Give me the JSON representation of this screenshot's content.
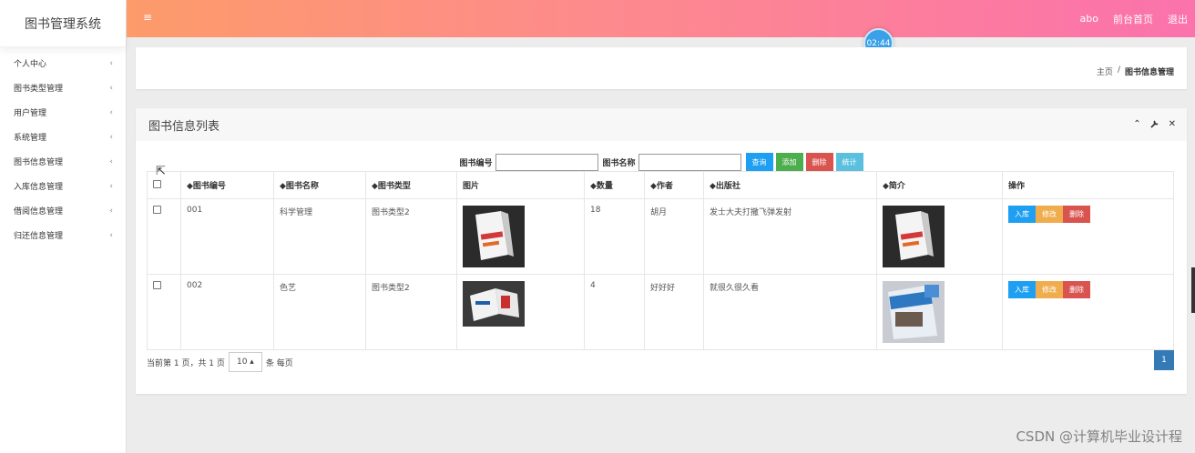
{
  "app": {
    "title": "图书管理系统",
    "menu_icon": "≡",
    "top_links": [
      "abo",
      "前台首页",
      "退出"
    ],
    "clock": "02:44"
  },
  "sidebar": {
    "items": [
      {
        "label": "个人中心"
      },
      {
        "label": "图书类型管理"
      },
      {
        "label": "用户管理"
      },
      {
        "label": "系统管理"
      },
      {
        "label": "图书信息管理"
      },
      {
        "label": "入库信息管理"
      },
      {
        "label": "借阅信息管理"
      },
      {
        "label": "归还信息管理"
      }
    ],
    "chevron": "‹"
  },
  "breadcrumb": {
    "home": "主页",
    "sep": "/",
    "current": "图书信息管理"
  },
  "panel": {
    "title": "图书信息列表",
    "tools": {
      "collapse": "⌃",
      "settings": "🔧",
      "close": "✕"
    }
  },
  "search": {
    "book_no_label": "图书编号",
    "book_no_value": "",
    "book_name_label": "图书名称",
    "book_name_value": "",
    "buttons": {
      "query": "查询",
      "add": "添加",
      "delete": "删除",
      "stats": "统计"
    }
  },
  "table": {
    "headers": [
      "◆图书编号",
      "◆图书名称",
      "◆图书类型",
      "图片",
      "◆数量",
      "◆作者",
      "◆出版社",
      "◆简介",
      "操作"
    ],
    "rows": [
      {
        "no": "001",
        "name": "科学管理",
        "type": "图书类型2",
        "qty": "18",
        "author": "胡月",
        "publisher": "发士大夫打撒飞弹发射"
      },
      {
        "no": "002",
        "name": "色艺",
        "type": "图书类型2",
        "qty": "4",
        "author": "好好好",
        "publisher": "就很久很久看"
      }
    ],
    "row_actions": {
      "stock_in": "入库",
      "edit": "修改",
      "delete": "删除"
    }
  },
  "pagination": {
    "summary": "当前第 1 页，共 1 页",
    "page_size": "10 ▴",
    "per_page": "条 每页",
    "current_page": "1"
  },
  "watermark": "CSDN @计算机毕业设计程",
  "colors": {
    "topbar_start": "#fd9b6a",
    "topbar_end": "#fb72ac",
    "primary": "#1e9ff2"
  }
}
